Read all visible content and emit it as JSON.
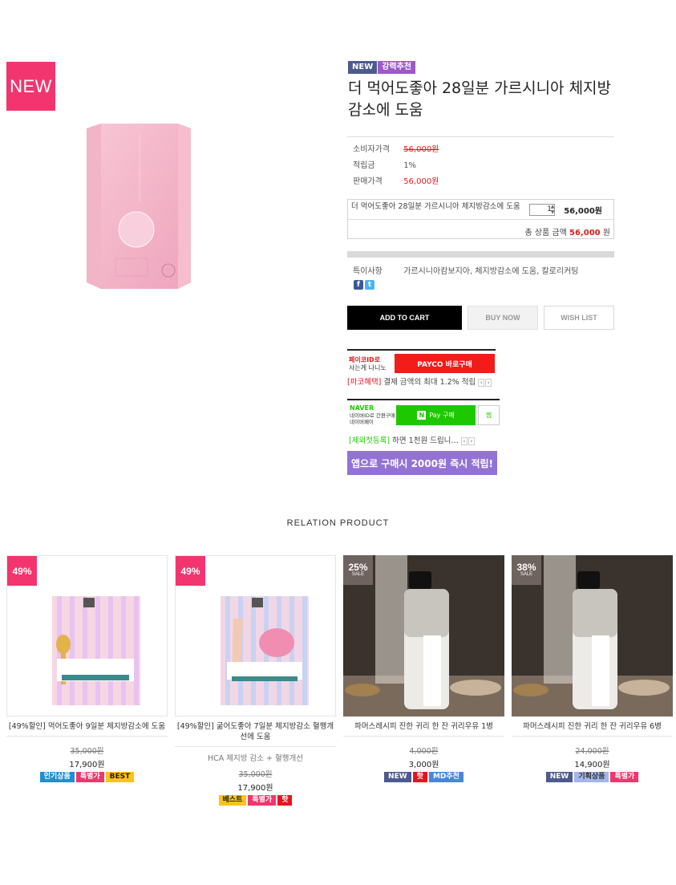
{
  "product": {
    "new_badge": "NEW",
    "tags": [
      "NEW",
      "강력추천"
    ],
    "title": "더 먹어도좋아 28일분 가르시니아 체지방감소에 도움",
    "info": [
      {
        "label": "소비자가격",
        "value": "56,000원"
      },
      {
        "label": "적립금",
        "value": "1%"
      },
      {
        "label": "판매가격",
        "value": "56,000원"
      }
    ],
    "option_name": "더 먹어도좋아 28일분 가르시니아 체지방감소에 도움",
    "quantity": "1",
    "option_price": "56,000원",
    "total_label": "총 상품 금액",
    "total_value": "56,000",
    "total_unit": "원",
    "spec_label": "특이사항",
    "spec_value": "가르시니아캄보지아, 체지방감소에 도움, 칼로리커팅",
    "buttons": {
      "cart": "ADD TO CART",
      "buy": "BUY NOW",
      "wish": "WISH LIST"
    }
  },
  "payco": {
    "line1": "페이코ID로",
    "line2": "사는게 나니노",
    "button": "PAYCO 바로구매",
    "tag": "[파코혜택]",
    "info": "결제 금액의 최대 1.2% 적립"
  },
  "naver": {
    "logo": "NAVER",
    "line1": "네이버ID로 간편구매",
    "line2": "네이버페이",
    "button": "Pay 구매",
    "zzim": "찜",
    "tag": "[제외첫등록]",
    "info": "하면 1천원 드립니…"
  },
  "app_banner": "앱으로 구매시 2000원 즉시 적립!",
  "relation_title": "RELATION PRODUCT",
  "related": [
    {
      "discount": "49%",
      "name": "[49%할인] 먹어도좋아 9일분 체지방감소에 도움",
      "sub": "",
      "old_price": "35,000원",
      "price": "17,900원",
      "badges": [
        "인기상품",
        "특별가",
        "BEST"
      ]
    },
    {
      "discount": "49%",
      "name": "[49%할인] 굶어도좋아 7일분 체지방감소 혈행개선에 도움",
      "sub": "HCA 체지방 감소 + 혈행개선",
      "old_price": "35,000원",
      "price": "17,900원",
      "badges": [
        "베스트",
        "특별가",
        "핫"
      ]
    },
    {
      "discount": "25%",
      "sale": "SALE",
      "name": "파머스레시피 진한 귀리 한 잔 귀리우유 1병",
      "sub": "",
      "old_price": "4,000원",
      "price": "3,000원",
      "badges": [
        "NEW",
        "핫",
        "MD추천"
      ]
    },
    {
      "discount": "38%",
      "sale": "SALE",
      "name": "파머스레시피 진한 귀리 한 잔 귀리우유 6병",
      "sub": "",
      "old_price": "24,000원",
      "price": "14,900원",
      "badges": [
        "NEW",
        "기획상품",
        "특별가"
      ]
    }
  ],
  "colors": {
    "accent_pink": "#f2356f",
    "red": "#e01b1b",
    "payco": "#f41b1b",
    "naver": "#1ec800",
    "app_banner": "#9372d6"
  }
}
